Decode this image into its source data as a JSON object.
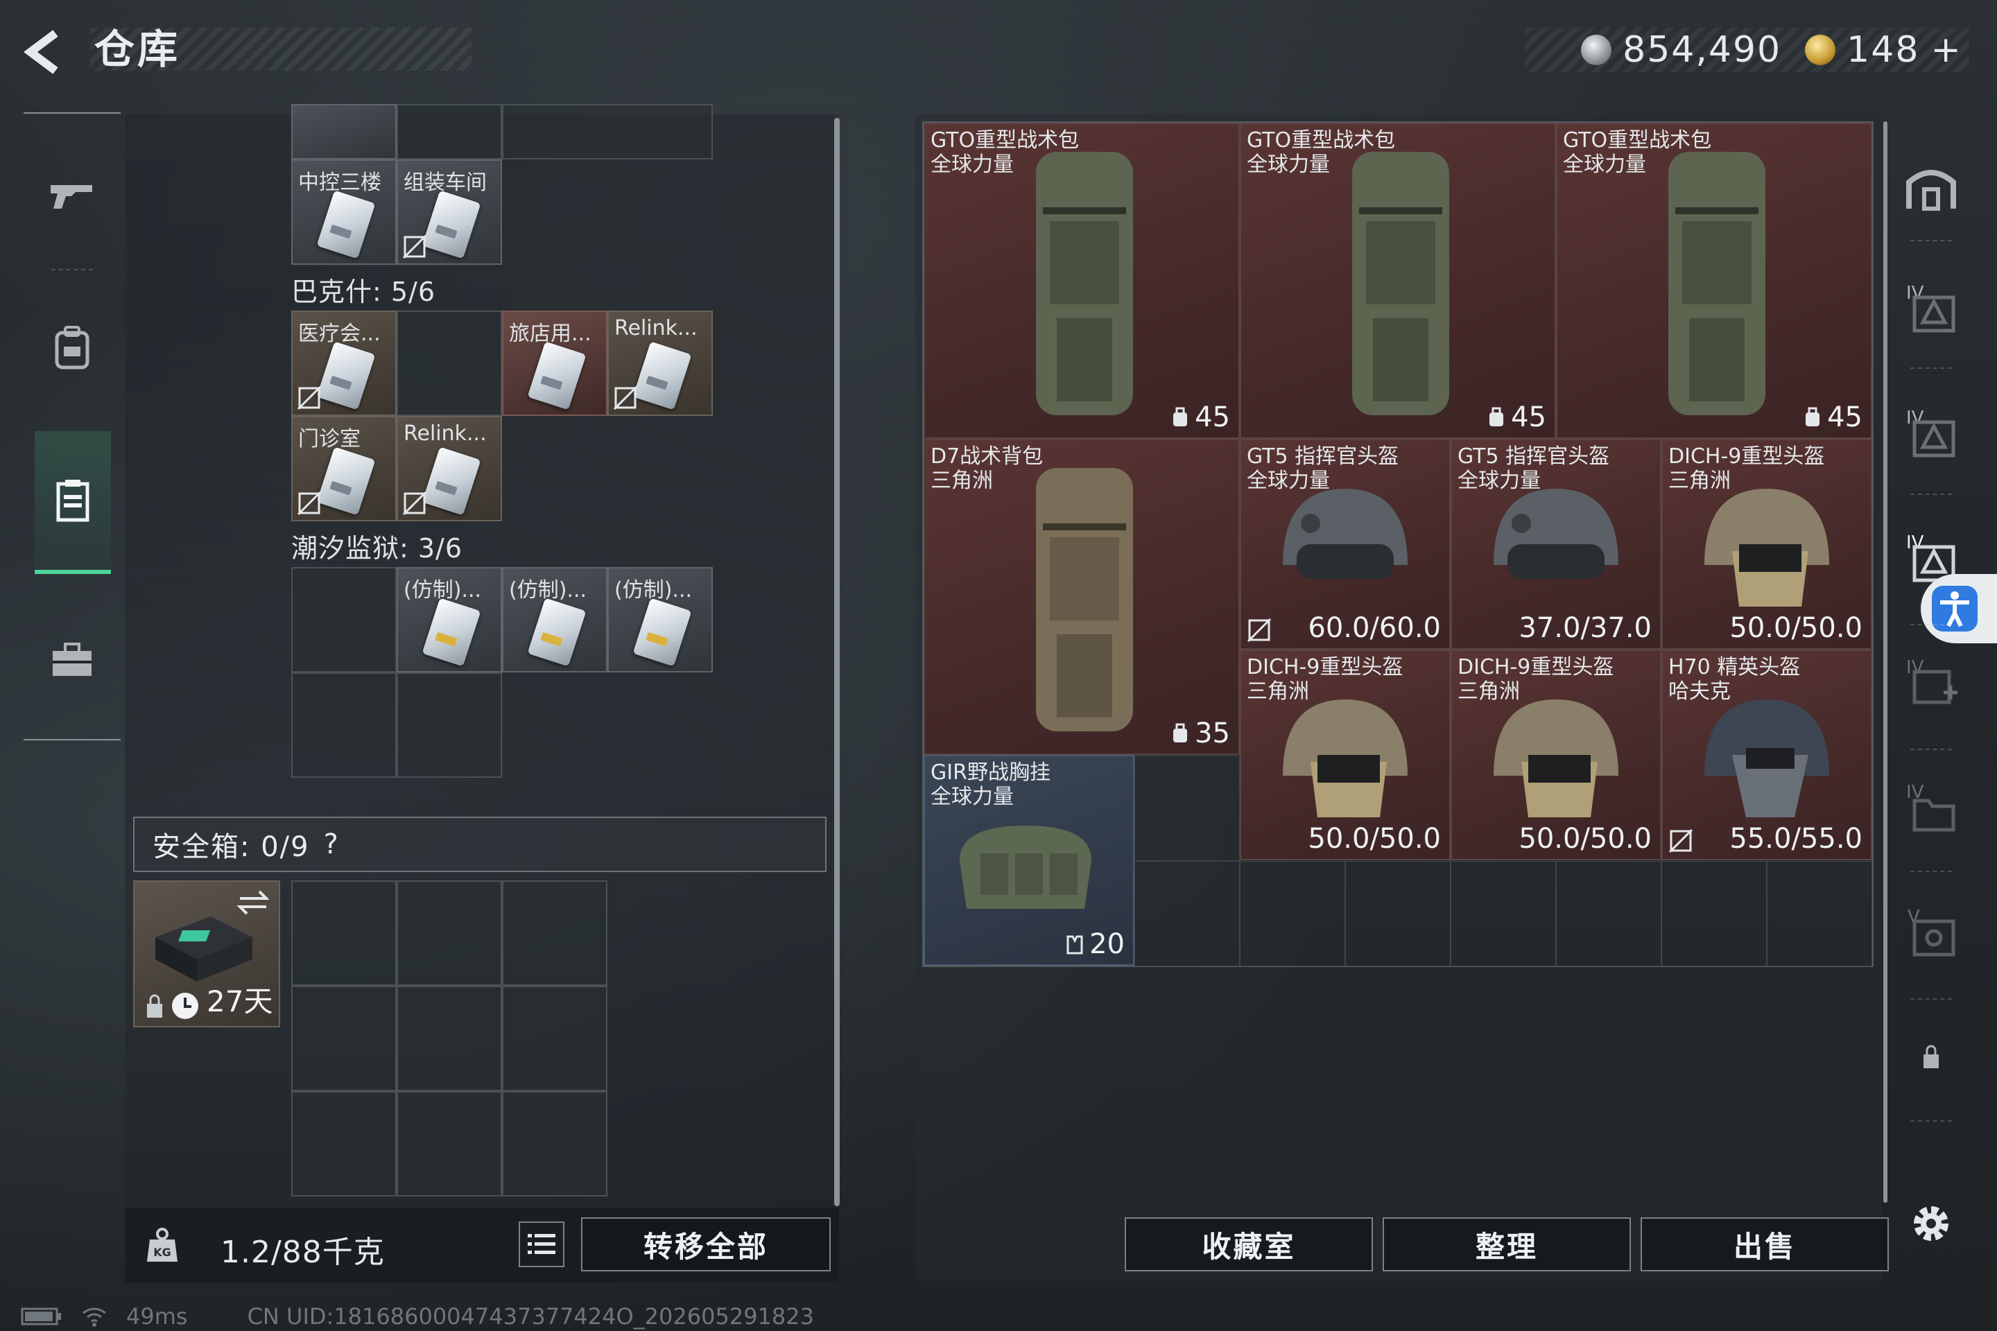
{
  "header": {
    "title": "仓库",
    "currency_1": "854,490",
    "currency_2": "148",
    "currency_plus": "+"
  },
  "left_rail": {
    "items": [
      {
        "name": "weapon-tab-icon"
      },
      {
        "name": "backpack-tab-icon"
      },
      {
        "name": "container-tab-icon",
        "active": true
      },
      {
        "name": "toolbox-tab-icon"
      }
    ]
  },
  "inventory": {
    "row0": {
      "labels": [
        "中控三楼",
        "组装车间"
      ]
    },
    "bakesh": {
      "label": "巴克什: 5/6",
      "items": [
        "医疗会...",
        "旅店用...",
        "Relink...",
        "门诊室",
        "Relink..."
      ]
    },
    "tidal": {
      "label": "潮汐监狱: 3/6",
      "items": [
        "(仿制)...",
        "(仿制)...",
        "(仿制)..."
      ]
    }
  },
  "safebox": {
    "label": "安全箱: 0/9",
    "help": "?",
    "days": "27天"
  },
  "footer": {
    "weight": "1.2/88千克",
    "transfer_all": "转移全部",
    "collection_room": "收藏室",
    "organize": "整理",
    "sell": "出售"
  },
  "stash": {
    "items": [
      {
        "name1": "GTO重型战术包",
        "name2": "全球力量",
        "stat": "45"
      },
      {
        "name1": "GTO重型战术包",
        "name2": "全球力量",
        "stat": "45"
      },
      {
        "name1": "GTO重型战术包",
        "name2": "全球力量",
        "stat": "45"
      },
      {
        "name1": "D7战术背包",
        "name2": "三角洲",
        "stat": "35"
      },
      {
        "name1": "GT5 指挥官头盔",
        "name2": "全球力量",
        "stat": "60.0/60.0"
      },
      {
        "name1": "GT5 指挥官头盔",
        "name2": "全球力量",
        "stat": "37.0/37.0"
      },
      {
        "name1": "DICH-9重型头盔",
        "name2": "三角洲",
        "stat": "50.0/50.0"
      },
      {
        "name1": "DICH-9重型头盔",
        "name2": "三角洲",
        "stat": "50.0/50.0"
      },
      {
        "name1": "DICH-9重型头盔",
        "name2": "三角洲",
        "stat": "50.0/50.0"
      },
      {
        "name1": "H70 精英头盔",
        "name2": "哈夫克",
        "stat": "55.0/55.0"
      },
      {
        "name1": "GIR野战胸挂",
        "name2": "全球力量",
        "stat": "20"
      }
    ]
  },
  "status": {
    "ping": "49ms",
    "uid": "CN UID:18168600047437377424O_202605291823"
  },
  "colors": {
    "accent_green": "#4fd39a",
    "item_red": "#472a2a",
    "access_blue": "#2f7be0"
  }
}
